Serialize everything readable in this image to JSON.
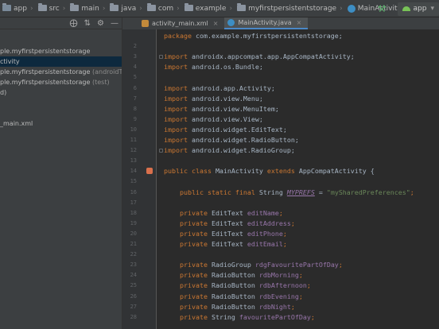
{
  "breadcrumb": {
    "items": [
      {
        "label": "app",
        "kind": "module"
      },
      {
        "label": "src",
        "kind": "folder"
      },
      {
        "label": "main",
        "kind": "folder"
      },
      {
        "label": "java",
        "kind": "folder"
      },
      {
        "label": "com",
        "kind": "folder"
      },
      {
        "label": "example",
        "kind": "folder"
      },
      {
        "label": "myfirstpersistentstorage",
        "kind": "folder"
      },
      {
        "label": "MainActivity",
        "kind": "class"
      }
    ],
    "run_config": "app"
  },
  "project_tree": {
    "rows": [
      {
        "text": "ple.myfirstpersistentstorage",
        "suffix": "",
        "selected": false
      },
      {
        "text": "ctivity",
        "suffix": "",
        "selected": true
      },
      {
        "text": "ple.myfirstpersistentstorage",
        "suffix": " (androidTest)",
        "selected": false
      },
      {
        "text": "ple.myfirstpersistentstorage",
        "suffix": " (test)",
        "selected": false
      },
      {
        "text": "d)",
        "suffix": "",
        "selected": false
      },
      {
        "text": "",
        "suffix": "",
        "selected": false
      },
      {
        "text": "",
        "suffix": "",
        "selected": false
      },
      {
        "text": "_main.xml",
        "suffix": "",
        "selected": false
      }
    ]
  },
  "tabs": [
    {
      "label": "activity_main.xml",
      "active": false,
      "icon": "xml-file-icon"
    },
    {
      "label": "MainActivity.java",
      "active": true,
      "icon": "java-class-icon"
    }
  ],
  "editor": {
    "lines": [
      {
        "n": "",
        "fold": false,
        "marker": false,
        "tokens": [
          {
            "t": "package ",
            "c": "kw"
          },
          {
            "t": "com.example.myfirstpersistentstorage;",
            "c": ""
          }
        ]
      },
      {
        "n": "2",
        "fold": false,
        "marker": false,
        "tokens": []
      },
      {
        "n": "3",
        "fold": true,
        "marker": false,
        "tokens": [
          {
            "t": "import ",
            "c": "kw"
          },
          {
            "t": "androidx.appcompat.app.AppCompatActivity;",
            "c": ""
          }
        ]
      },
      {
        "n": "4",
        "fold": false,
        "marker": false,
        "tokens": [
          {
            "t": "import ",
            "c": "kw"
          },
          {
            "t": "android.os.Bundle;",
            "c": ""
          }
        ]
      },
      {
        "n": "5",
        "fold": false,
        "marker": false,
        "tokens": []
      },
      {
        "n": "6",
        "fold": false,
        "marker": false,
        "tokens": [
          {
            "t": "import ",
            "c": "kw"
          },
          {
            "t": "android.app.Activity;",
            "c": ""
          }
        ]
      },
      {
        "n": "7",
        "fold": false,
        "marker": false,
        "tokens": [
          {
            "t": "import ",
            "c": "kw"
          },
          {
            "t": "android.view.Menu;",
            "c": ""
          }
        ]
      },
      {
        "n": "8",
        "fold": false,
        "marker": false,
        "tokens": [
          {
            "t": "import ",
            "c": "kw"
          },
          {
            "t": "android.view.MenuItem;",
            "c": ""
          }
        ]
      },
      {
        "n": "9",
        "fold": false,
        "marker": false,
        "tokens": [
          {
            "t": "import ",
            "c": "kw"
          },
          {
            "t": "android.view.View;",
            "c": ""
          }
        ]
      },
      {
        "n": "10",
        "fold": false,
        "marker": false,
        "tokens": [
          {
            "t": "import ",
            "c": "kw"
          },
          {
            "t": "android.widget.EditText;",
            "c": ""
          }
        ]
      },
      {
        "n": "11",
        "fold": false,
        "marker": false,
        "tokens": [
          {
            "t": "import ",
            "c": "kw"
          },
          {
            "t": "android.widget.RadioButton;",
            "c": ""
          }
        ]
      },
      {
        "n": "12",
        "fold": true,
        "marker": false,
        "tokens": [
          {
            "t": "import ",
            "c": "kw"
          },
          {
            "t": "android.widget.RadioGroup;",
            "c": ""
          }
        ]
      },
      {
        "n": "13",
        "fold": false,
        "marker": false,
        "tokens": []
      },
      {
        "n": "14",
        "fold": false,
        "marker": true,
        "tokens": [
          {
            "t": "public class ",
            "c": "kw"
          },
          {
            "t": "MainActivity ",
            "c": ""
          },
          {
            "t": "extends ",
            "c": "kw"
          },
          {
            "t": "AppCompatActivity {",
            "c": ""
          }
        ]
      },
      {
        "n": "15",
        "fold": false,
        "marker": false,
        "tokens": []
      },
      {
        "n": "16",
        "fold": false,
        "marker": false,
        "tokens": [
          {
            "t": "    public static final ",
            "c": "kw"
          },
          {
            "t": "String ",
            "c": ""
          },
          {
            "t": "MYPREFS",
            "c": "cst"
          },
          {
            "t": " = ",
            "c": ""
          },
          {
            "t": "\"mySharedPreferences\"",
            "c": "str"
          },
          {
            "t": ";",
            "c": "kw"
          }
        ]
      },
      {
        "n": "17",
        "fold": false,
        "marker": false,
        "tokens": []
      },
      {
        "n": "18",
        "fold": false,
        "marker": false,
        "tokens": [
          {
            "t": "    private ",
            "c": "kw"
          },
          {
            "t": "EditText ",
            "c": ""
          },
          {
            "t": "editName",
            "c": "fld"
          },
          {
            "t": ";",
            "c": "kw"
          }
        ]
      },
      {
        "n": "19",
        "fold": false,
        "marker": false,
        "tokens": [
          {
            "t": "    private ",
            "c": "kw"
          },
          {
            "t": "EditText ",
            "c": ""
          },
          {
            "t": "editAddress",
            "c": "fld"
          },
          {
            "t": ";",
            "c": "kw"
          }
        ]
      },
      {
        "n": "20",
        "fold": false,
        "marker": false,
        "tokens": [
          {
            "t": "    private ",
            "c": "kw"
          },
          {
            "t": "EditText ",
            "c": ""
          },
          {
            "t": "editPhone",
            "c": "fld"
          },
          {
            "t": ";",
            "c": "kw"
          }
        ]
      },
      {
        "n": "21",
        "fold": false,
        "marker": false,
        "tokens": [
          {
            "t": "    private ",
            "c": "kw"
          },
          {
            "t": "EditText ",
            "c": ""
          },
          {
            "t": "editEmail",
            "c": "fld"
          },
          {
            "t": ";",
            "c": "kw"
          }
        ]
      },
      {
        "n": "22",
        "fold": false,
        "marker": false,
        "tokens": []
      },
      {
        "n": "23",
        "fold": false,
        "marker": false,
        "tokens": [
          {
            "t": "    private ",
            "c": "kw"
          },
          {
            "t": "RadioGroup ",
            "c": ""
          },
          {
            "t": "rdgFavouritePartOfDay",
            "c": "fld"
          },
          {
            "t": ";",
            "c": "kw"
          }
        ]
      },
      {
        "n": "24",
        "fold": false,
        "marker": false,
        "tokens": [
          {
            "t": "    private ",
            "c": "kw"
          },
          {
            "t": "RadioButton ",
            "c": ""
          },
          {
            "t": "rdbMorning",
            "c": "fld"
          },
          {
            "t": ";",
            "c": "kw"
          }
        ]
      },
      {
        "n": "25",
        "fold": false,
        "marker": false,
        "tokens": [
          {
            "t": "    private ",
            "c": "kw"
          },
          {
            "t": "RadioButton ",
            "c": ""
          },
          {
            "t": "rdbAfternoon",
            "c": "fld"
          },
          {
            "t": ";",
            "c": "kw"
          }
        ]
      },
      {
        "n": "26",
        "fold": false,
        "marker": false,
        "tokens": [
          {
            "t": "    private ",
            "c": "kw"
          },
          {
            "t": "RadioButton ",
            "c": ""
          },
          {
            "t": "rdbEvening",
            "c": "fld"
          },
          {
            "t": ";",
            "c": "kw"
          }
        ]
      },
      {
        "n": "27",
        "fold": false,
        "marker": false,
        "tokens": [
          {
            "t": "    private ",
            "c": "kw"
          },
          {
            "t": "RadioButton ",
            "c": ""
          },
          {
            "t": "rdbNight",
            "c": "fld"
          },
          {
            "t": ";",
            "c": "kw"
          }
        ]
      },
      {
        "n": "28",
        "fold": false,
        "marker": false,
        "tokens": [
          {
            "t": "    private ",
            "c": "kw"
          },
          {
            "t": "String ",
            "c": ""
          },
          {
            "t": "favouritePartOfDay",
            "c": "fld"
          },
          {
            "t": ";",
            "c": "kw"
          }
        ]
      }
    ]
  },
  "theme": {
    "accent": "#4a88c7",
    "keyword": "#cc7832",
    "field": "#9876aa",
    "string": "#6a8759"
  }
}
